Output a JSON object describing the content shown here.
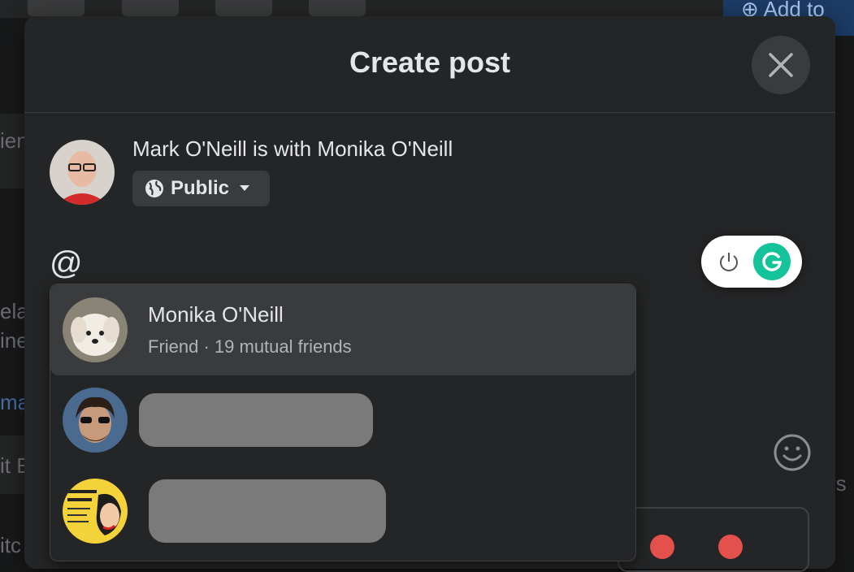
{
  "background": {
    "add_button_label": "Add to",
    "side_fragments": [
      "ien",
      "ela",
      "ine",
      "ma",
      "it E",
      "itc",
      "rs"
    ]
  },
  "modal": {
    "title": "Create post",
    "author_line": "Mark O'Neill is with Monika O'Neill",
    "audience_label": "Public",
    "composer_text": "@"
  },
  "mentions": [
    {
      "name": "Monika O'Neill",
      "subtitle": "Friend · 19 mutual friends",
      "active": true
    },
    {
      "name": "",
      "subtitle": "",
      "redacted": true
    },
    {
      "name": "",
      "subtitle": "",
      "redacted": true
    }
  ],
  "icons": {
    "close": "close-icon",
    "audience": "globe-icon",
    "audience_dropdown": "caret-down-icon",
    "grammarly_power": "power-icon",
    "grammarly_logo": "grammarly-icon",
    "emoji": "emoji-icon"
  },
  "colors": {
    "modal_bg": "#242526",
    "page_bg": "#18191a",
    "text_primary": "#e4e6eb",
    "text_secondary": "#b0b3b8",
    "grammarly_green": "#15c39a"
  }
}
